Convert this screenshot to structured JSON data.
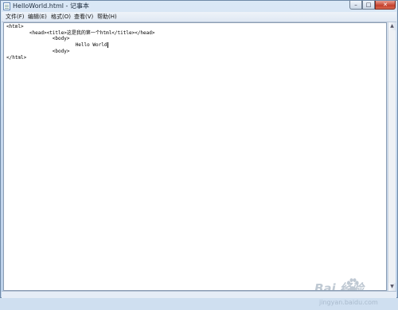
{
  "window": {
    "title": "HelloWorld.html - 记事本",
    "buttons": {
      "minimize": "–",
      "maximize": "□",
      "close": "✕"
    }
  },
  "menubar": {
    "items": [
      "文件(F)",
      "编辑(E)",
      "格式(O)",
      "查看(V)",
      "帮助(H)"
    ]
  },
  "editor": {
    "lines": [
      "<html>",
      "        <head><title>这是我的第一个html</title></head>",
      "                <body>",
      "                        Hello World",
      "                <body>",
      "</html>"
    ]
  },
  "watermark": {
    "brand": "Bai 经验",
    "url": "jingyan.baidu.com"
  }
}
